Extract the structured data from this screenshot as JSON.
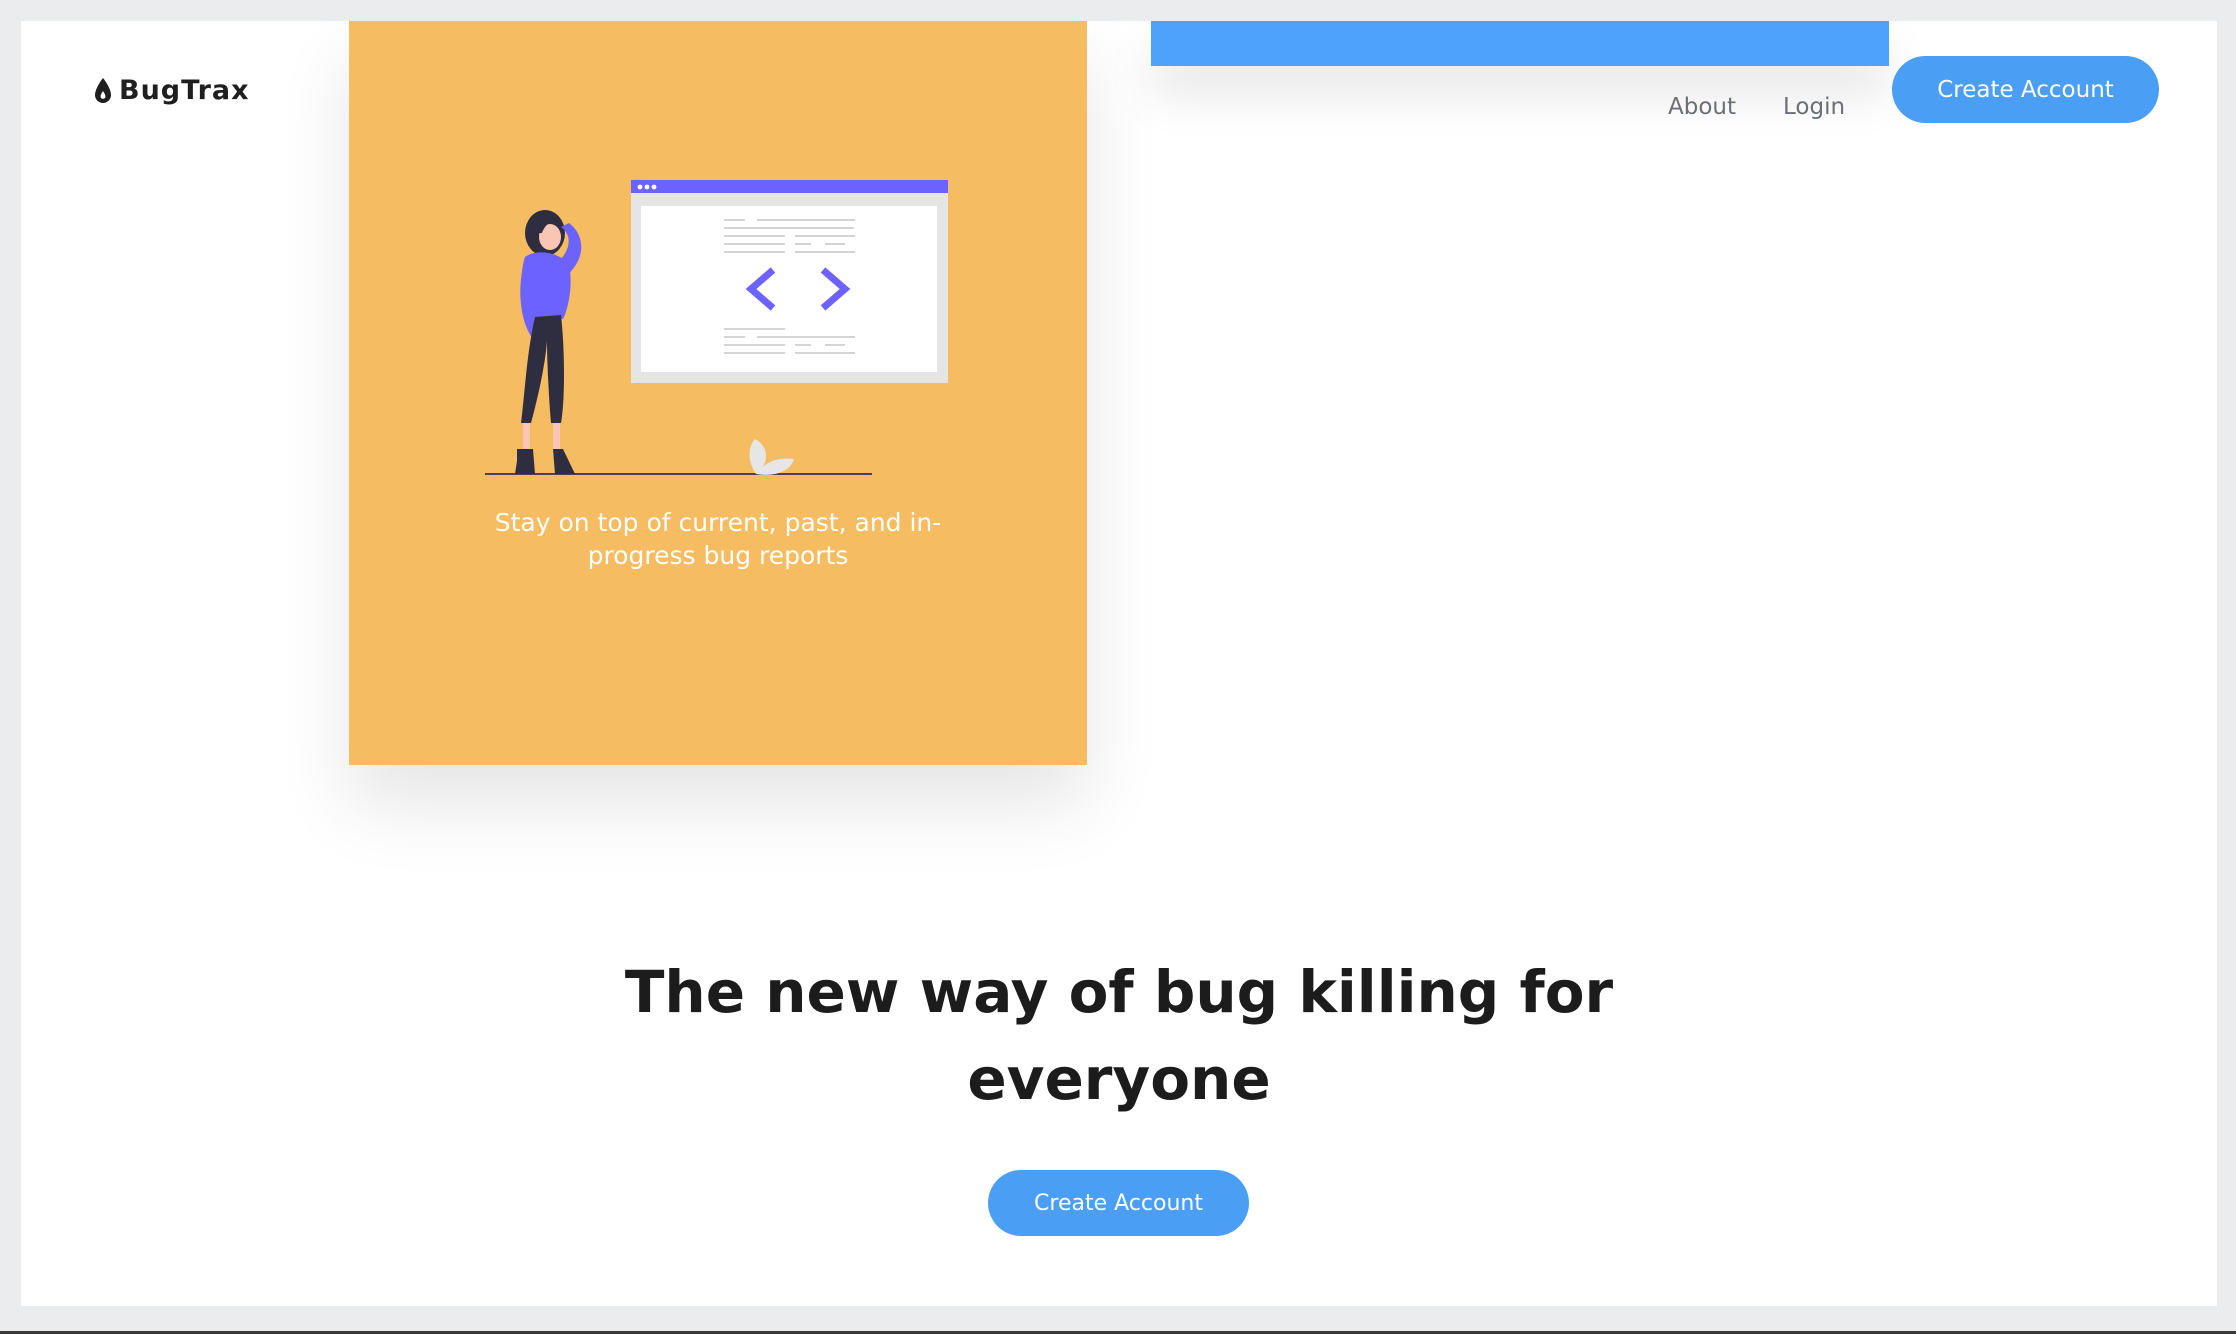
{
  "brand": {
    "name": "BugTrax",
    "icon": "drop-icon"
  },
  "nav": {
    "about": "About",
    "login": "Login",
    "create_account": "Create Account"
  },
  "feature_card": {
    "caption": "Stay on top of current, past, and in-progress bug reports",
    "illustration": "person-with-code-window-illustration",
    "background_color": "#f5bc62"
  },
  "hero": {
    "title": "The new way of bug killing for everyone",
    "cta": "Create Account"
  },
  "colors": {
    "accent": "#4a9ff5",
    "illustration_purple": "#6c63ff"
  }
}
